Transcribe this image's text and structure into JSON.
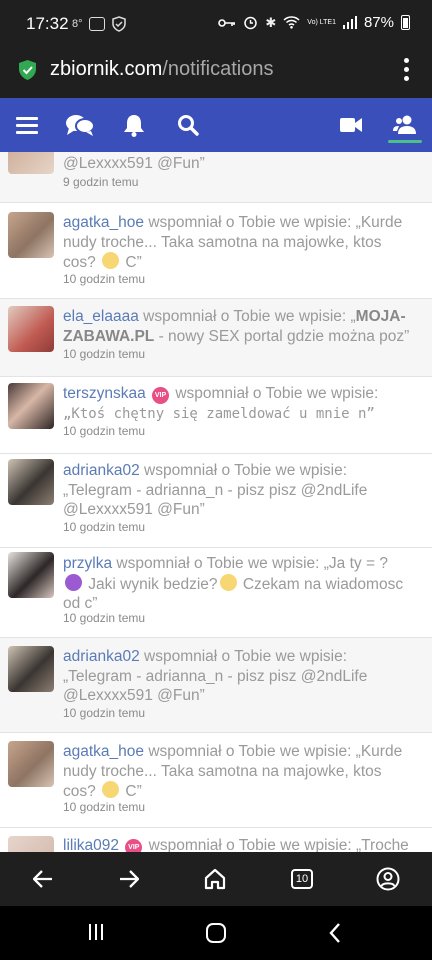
{
  "status": {
    "time": "17:32",
    "temp": "8°",
    "battery": "87%",
    "net_label": "Vo) LTE1"
  },
  "browser": {
    "url_host": "zbiornik.com",
    "url_path": "/notifications",
    "tab_count": "10"
  },
  "site_nav": {
    "items": [
      "menu-icon",
      "chat-icon",
      "bell-icon",
      "search-icon",
      "video-icon",
      "friends-icon"
    ]
  },
  "notifications": [
    {
      "user": "",
      "message_a": "@Lexxxx591 @Fun”",
      "time": "9 godzin temu"
    },
    {
      "user": "agatka_hoe",
      "message_a": " wspomniał o Tobie we wpisie: „Kurde nudy troche... Taka samotna na majowke, ktos cos? ",
      "message_b": " C”",
      "time": "10 godzin temu"
    },
    {
      "user": "ela_elaaaa",
      "message_a": " wspomniał o Tobie we wpisie: „",
      "bold": "MOJA-ZABAWA.PL",
      "message_b": " - nowy SEX portal gdzie można poz”",
      "time": "10 godzin temu"
    },
    {
      "user": "terszynskaa",
      "vip": "VIP",
      "message_a": " wspomniał o Tobie we wpisie:",
      "mono": "„Ktoś chętny się zameldować u mnie n”",
      "time": "10 godzin temu"
    },
    {
      "user": "adrianka02",
      "message_a": " wspomniał o Tobie we wpisie: „Telegram - adrianna_n - pisz pisz @2ndLife @Lexxxx591 @Fun”",
      "time": "10 godzin temu"
    },
    {
      "user": "przylka",
      "message_a": " wspomniał o Tobie we wpisie: „Ja ty = ? ",
      "message_b": " Jaki wynik bedzie?",
      "message_c": " Czekam na wiadomosc od c”",
      "time": "10 godzin temu"
    },
    {
      "user": "adrianka02",
      "message_a": " wspomniał o Tobie we wpisie: „Telegram - adrianna_n - pisz pisz @2ndLife @Lexxxx591 @Fun”",
      "time": "10 godzin temu"
    },
    {
      "user": "agatka_hoe",
      "message_a": " wspomniał o Tobie we wpisie: „Kurde nudy troche... Taka samotna na majowke, ktos cos? ",
      "message_b": " C”",
      "time": "10 godzin temu"
    },
    {
      "user": "lilika092",
      "vip": "VIP",
      "message_a": " wspomniał o Tobie we wpisie: „Troche",
      "time": ""
    }
  ],
  "colors": {
    "nav_bg": "#3a4fba",
    "username": "#5b7bb6",
    "active_underline": "#4cc08a",
    "vip_badge": "#e84f86"
  }
}
